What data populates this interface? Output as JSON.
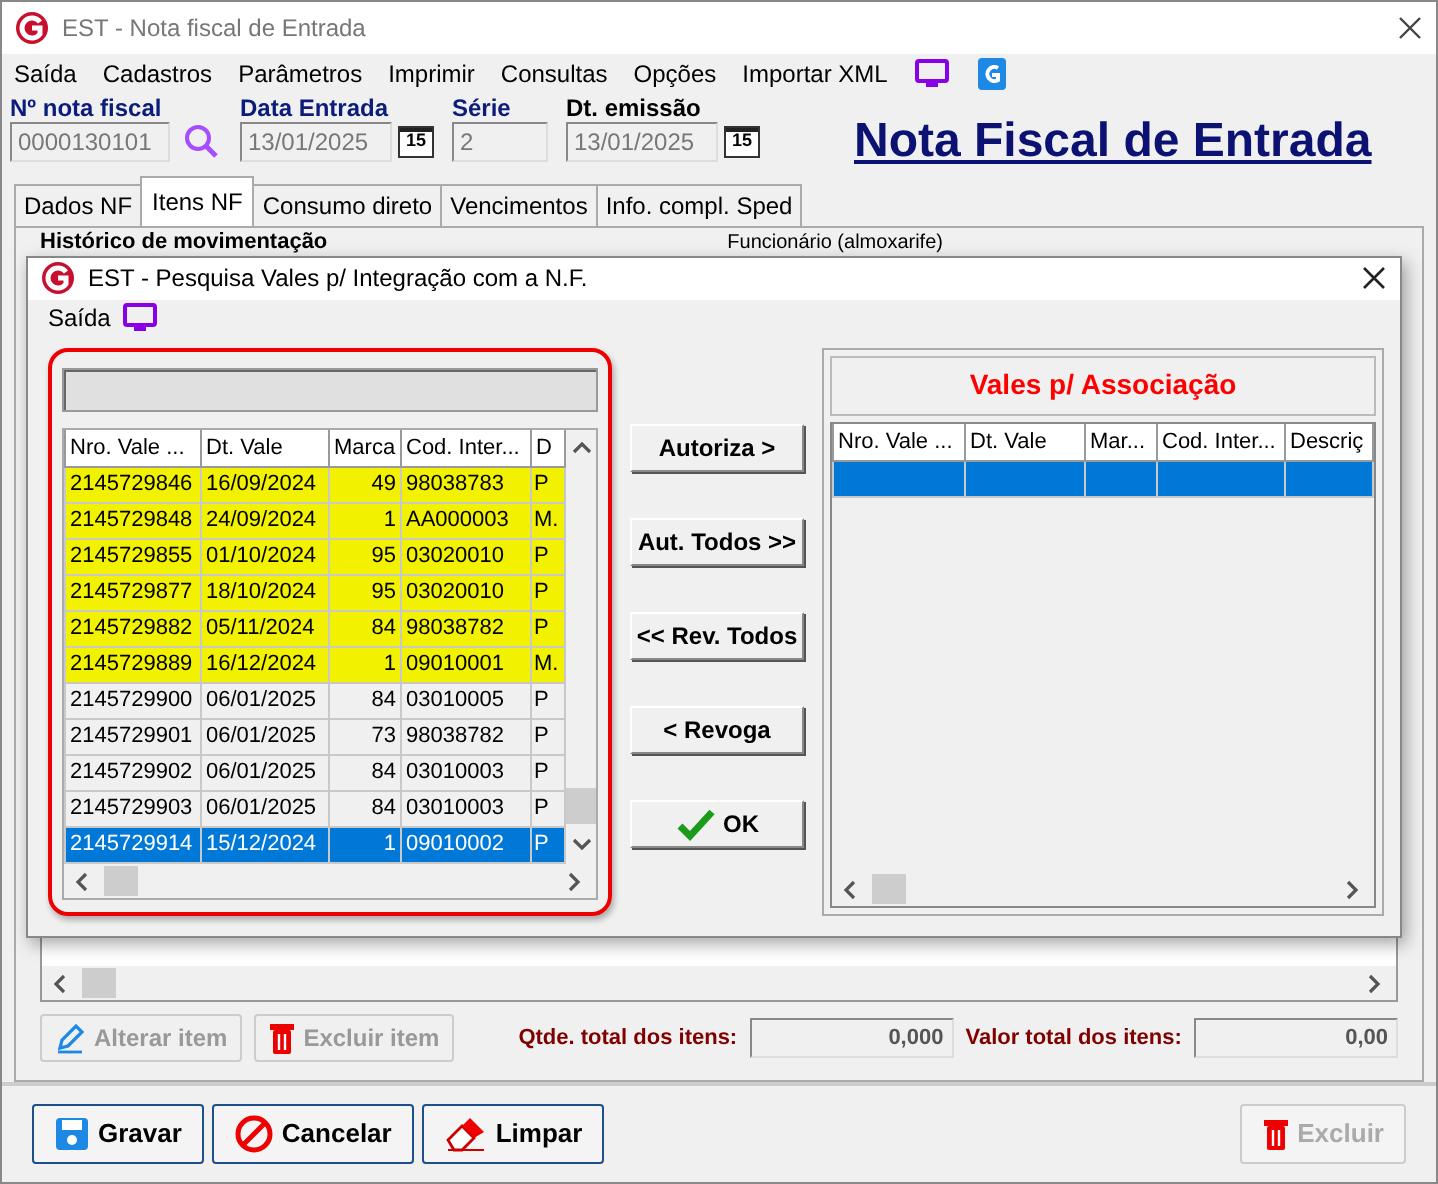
{
  "window": {
    "title": "EST - Nota fiscal de Entrada"
  },
  "menu": [
    "Saída",
    "Cadastros",
    "Parâmetros",
    "Imprimir",
    "Consultas",
    "Opções",
    "Importar XML"
  ],
  "header_fields": [
    {
      "label": "Nº nota fiscal",
      "value": "0000130101",
      "kind": "search"
    },
    {
      "label": "Data Entrada",
      "value": "13/01/2025",
      "kind": "date",
      "calendar_day": "15"
    },
    {
      "label": "Série",
      "value": "2",
      "kind": "text"
    },
    {
      "label": "Dt. emissão",
      "value": "13/01/2025",
      "kind": "date",
      "calendar_day": "15"
    }
  ],
  "page_title": "Nota Fiscal de Entrada",
  "tabs": [
    {
      "label": "Dados NF",
      "selected": false
    },
    {
      "label": "Itens NF",
      "selected": true
    },
    {
      "label": "Consumo direto",
      "selected": false
    },
    {
      "label": "Vencimentos",
      "selected": false
    },
    {
      "label": "Info. compl. Sped",
      "selected": false
    }
  ],
  "behind_labels": [
    "Histórico de movimentação",
    "Funcionário (almoxarife)"
  ],
  "item_actions": [
    {
      "label": "Alterar item",
      "kind": "edit",
      "disabled": true
    },
    {
      "label": "Excluir item",
      "kind": "delete",
      "disabled": true
    }
  ],
  "totals": [
    {
      "label": "Qtde. total dos itens:",
      "value": "0,000"
    },
    {
      "label": "Valor total dos itens:",
      "value": "0,00"
    }
  ],
  "footer_buttons": [
    {
      "label": "Gravar",
      "kind": "save",
      "disabled": false
    },
    {
      "label": "Cancelar",
      "kind": "cancel",
      "disabled": false
    },
    {
      "label": "Limpar",
      "kind": "clear",
      "disabled": false
    },
    {
      "label": "Excluir",
      "kind": "delete",
      "disabled": true
    }
  ],
  "dialog": {
    "title": "EST - Pesquisa Vales p/ Integração com a N.F.",
    "menu": [
      "Saída"
    ],
    "vouchers": {
      "columns": [
        "Nro. Vale ...",
        "Dt. Vale",
        "Marca",
        "Cod. Inter...",
        "D"
      ],
      "rows": [
        {
          "cells": [
            "2145729846",
            "16/09/2024",
            "49",
            "98038783",
            "P"
          ],
          "highlighted": true,
          "selected": false
        },
        {
          "cells": [
            "2145729848",
            "24/09/2024",
            "1",
            "AA000003",
            "M."
          ],
          "highlighted": true,
          "selected": false
        },
        {
          "cells": [
            "2145729855",
            "01/10/2024",
            "95",
            "03020010",
            "P"
          ],
          "highlighted": true,
          "selected": false
        },
        {
          "cells": [
            "2145729877",
            "18/10/2024",
            "95",
            "03020010",
            "P"
          ],
          "highlighted": true,
          "selected": false
        },
        {
          "cells": [
            "2145729882",
            "05/11/2024",
            "84",
            "98038782",
            "P"
          ],
          "highlighted": true,
          "selected": false
        },
        {
          "cells": [
            "2145729889",
            "16/12/2024",
            "1",
            "09010001",
            "M."
          ],
          "highlighted": true,
          "selected": false
        },
        {
          "cells": [
            "2145729900",
            "06/01/2025",
            "84",
            "03010005",
            "P"
          ],
          "highlighted": false,
          "selected": false
        },
        {
          "cells": [
            "2145729901",
            "06/01/2025",
            "73",
            "98038782",
            "P"
          ],
          "highlighted": false,
          "selected": false
        },
        {
          "cells": [
            "2145729902",
            "06/01/2025",
            "84",
            "03010003",
            "P"
          ],
          "highlighted": false,
          "selected": false
        },
        {
          "cells": [
            "2145729903",
            "06/01/2025",
            "84",
            "03010003",
            "P"
          ],
          "highlighted": false,
          "selected": false
        },
        {
          "cells": [
            "2145729914",
            "15/12/2024",
            "1",
            "09010002",
            "P"
          ],
          "highlighted": false,
          "selected": true
        }
      ]
    },
    "actions": [
      {
        "label": "Autoriza >",
        "kind": "text"
      },
      {
        "label": "Aut. Todos >>",
        "kind": "text"
      },
      {
        "label": "<< Rev. Todos",
        "kind": "text"
      },
      {
        "label": "< Revoga",
        "kind": "text"
      },
      {
        "label": "OK",
        "kind": "ok"
      }
    ],
    "association": {
      "title": "Vales p/ Associação",
      "columns": [
        "Nro. Vale ...",
        "Dt. Vale",
        "Mar...",
        "Cod. Inter...",
        "Descriç"
      ],
      "rows": [
        {
          "selected": true
        }
      ]
    }
  }
}
